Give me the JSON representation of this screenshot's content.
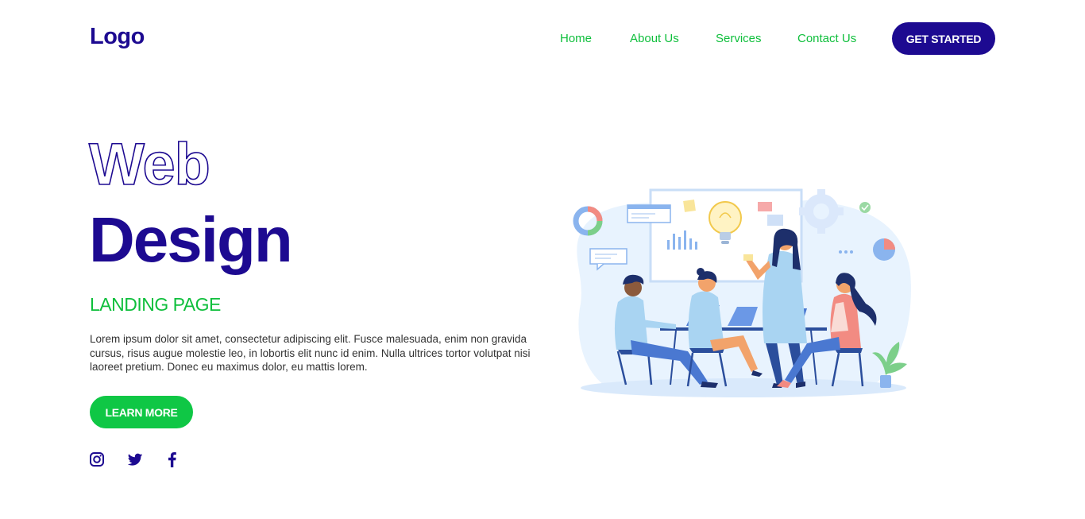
{
  "header": {
    "logo": "Logo",
    "nav": [
      "Home",
      "About Us",
      "Services",
      "Contact Us"
    ],
    "cta_label": "GET STARTED"
  },
  "hero": {
    "title_outline": "Web",
    "title_solid": "Design",
    "subtitle": "LANDING PAGE",
    "body": "Lorem ipsum dolor sit amet, consectetur adipiscing elit. Fusce malesuada, enim non gravida cursus, risus augue molestie leo, in lobortis elit nunc id enim. Nulla ultrices tortor volutpat nisi laoreet pretium. Donec eu maximus dolor, eu mattis lorem.",
    "button_label": "LEARN MORE"
  },
  "social": {
    "icons": [
      "instagram-icon",
      "twitter-icon",
      "facebook-icon"
    ]
  },
  "colors": {
    "primary": "#1d0a91",
    "accent": "#0fbf3c",
    "button_green": "#0fc745"
  }
}
